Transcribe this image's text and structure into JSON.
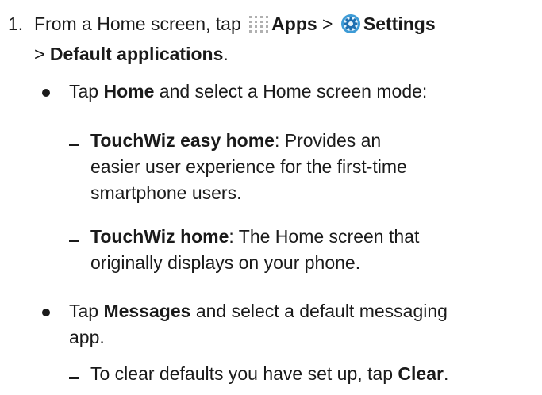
{
  "step": {
    "number": "1.",
    "line1_prefix": "From a Home screen, tap",
    "apps_label": "Apps",
    "sep1": ">",
    "settings_label": "Settings",
    "sep2": ">",
    "default_apps_label": "Default applications",
    "end_period": "."
  },
  "bullets": [
    {
      "prefix": "Tap",
      "bold": "Home",
      "suffix": "and select a Home screen mode:",
      "subitems": [
        {
          "bold": "TouchWiz easy home",
          "line1": ": Provides an",
          "line2": "easier user experience for the first-time",
          "line3": "smartphone users."
        },
        {
          "bold": "TouchWiz home",
          "line1": ": The Home screen that",
          "line2": "originally displays on your phone."
        }
      ]
    },
    {
      "prefix": "Tap",
      "bold": "Messages",
      "suffix": "and select a default messaging",
      "line2": "app.",
      "subitems": [
        {
          "text": "To clear defaults you have set up, tap",
          "bold": "Clear",
          "end": "."
        }
      ]
    }
  ],
  "icons": {
    "apps": "apps-grid-icon",
    "settings": "settings-gear-icon"
  },
  "colors": {
    "text": "#1a1a1a",
    "apps_icon": "#b0b0b0",
    "settings_icon_outer": "#3d9bd6",
    "settings_icon_inner": "#1e6fb0"
  }
}
